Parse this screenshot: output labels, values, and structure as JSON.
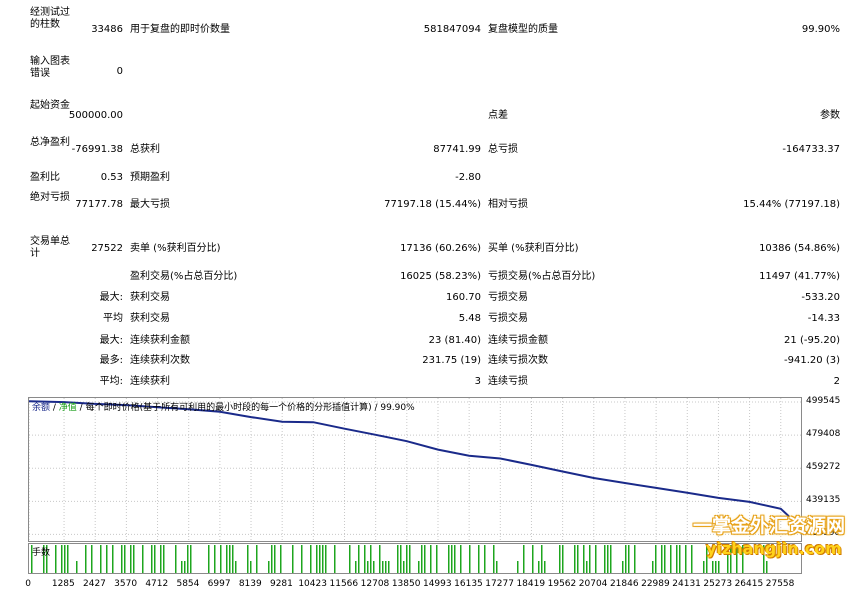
{
  "report": {
    "bars_label": "经测试过的柱数",
    "bars_value": "33486",
    "ticks_label": "用于复盘的即时价数量",
    "ticks_value": "581847094",
    "quality_label": "复盘模型的质量",
    "quality_value": "99.90%",
    "mismatch_label": "输入图表错误",
    "mismatch_value": "0",
    "deposit_label": "起始资金",
    "deposit_value": "500000.00",
    "spread_label": "点差",
    "spread_value": "参数",
    "net_label": "总净盈利",
    "net_value": "-76991.38",
    "gross_profit_label": "总获利",
    "gross_profit_value": "87741.99",
    "gross_loss_label": "总亏损",
    "gross_loss_value": "-164733.37",
    "pf_label": "盈利比",
    "pf_value": "0.53",
    "expected_label": "预期盈利",
    "expected_value": "-2.80",
    "abs_dd_label": "绝对亏损",
    "abs_dd_value": "77177.78",
    "max_dd_label": "最大亏损",
    "max_dd_value": "77197.18 (15.44%)",
    "rel_dd_label": "相对亏损",
    "rel_dd_value": "15.44% (77197.18)",
    "trades_label": "交易单总计",
    "trades_value": "27522",
    "short_label": "卖单 (%获利百分比)",
    "short_value": "17136 (60.26%)",
    "long_label": "买单 (%获利百分比)",
    "long_value": "10386 (54.86%)",
    "profit_trades_label": "盈利交易(%占总百分比)",
    "profit_trades_value": "16025 (58.23%)",
    "loss_trades_label": "亏损交易(%占总百分比)",
    "loss_trades_value": "11497 (41.77%)",
    "largest_prefix": "最大:",
    "largest_profit_label": "获利交易",
    "largest_profit_value": "160.70",
    "largest_loss_label": "亏损交易",
    "largest_loss_value": "-533.20",
    "avg_prefix": "平均",
    "avg_profit_label": "获利交易",
    "avg_profit_value": "5.48",
    "avg_loss_label": "亏损交易",
    "avg_loss_value": "-14.33",
    "max_prefix": "最大:",
    "max_cons_wins_label": "连续获利金额",
    "max_cons_wins_value": "23 (81.40)",
    "max_cons_losses_label": "连续亏损金额",
    "max_cons_losses_value": "21 (-95.20)",
    "most_prefix": "最多:",
    "max_cons_profit_label": "连续获利次数",
    "max_cons_profit_value": "231.75 (19)",
    "max_cons_loss_label": "连续亏损次数",
    "max_cons_loss_value": "-941.20 (3)",
    "avgc_prefix": "平均:",
    "avg_cons_wins_label": "连续获利",
    "avg_cons_wins_value": "3",
    "avg_cons_losses_label": "连续亏损",
    "avg_cons_losses_value": "2"
  },
  "chart_title": {
    "balance": "余额",
    "sep1": " / ",
    "equity": "净值",
    "sep2": " / ",
    "rest": "每个即时价格(基于所有可利用的最小时段的每一个价格的分形插值计算) / 99.90%"
  },
  "volume_label": "手数",
  "watermark": {
    "text1": "一掌金外汇资源网",
    "text2": "yizhangjin.com"
  },
  "colors": {
    "balance_line": "#1a2a8a",
    "volume_bars": "#1ea51e",
    "grid": "#c8c8c8"
  },
  "chart_data": {
    "type": "line",
    "y_ticks": [
      "499545",
      "479408",
      "459272",
      "439135",
      "418998"
    ],
    "ylim": [
      415000,
      502000
    ],
    "x_ticks": [
      "0",
      "1285",
      "2427",
      "3570",
      "4712",
      "5854",
      "6997",
      "8139",
      "9281",
      "10423",
      "11566",
      "12708",
      "13850",
      "14993",
      "16135",
      "17277",
      "18419",
      "19562",
      "20704",
      "21846",
      "22989",
      "24131",
      "25273",
      "26415",
      "27558"
    ],
    "xlim": [
      0,
      28300
    ],
    "series": [
      {
        "x": [
          0,
          1285,
          2427,
          3570,
          4712,
          5854,
          6997,
          8139,
          9281,
          10423,
          11566,
          12708,
          13850,
          14993,
          16135,
          17277,
          18419,
          19562,
          20704,
          21846,
          22989,
          24131,
          25273,
          26415,
          27558,
          28300
        ],
        "values": [
          500000,
          499500,
          498400,
          497700,
          496400,
          495200,
          493600,
          490400,
          487600,
          487300,
          483300,
          479600,
          475700,
          470600,
          466900,
          465200,
          461300,
          457300,
          453300,
          450300,
          447300,
          444300,
          441200,
          438800,
          434600,
          423200
        ]
      }
    ]
  }
}
